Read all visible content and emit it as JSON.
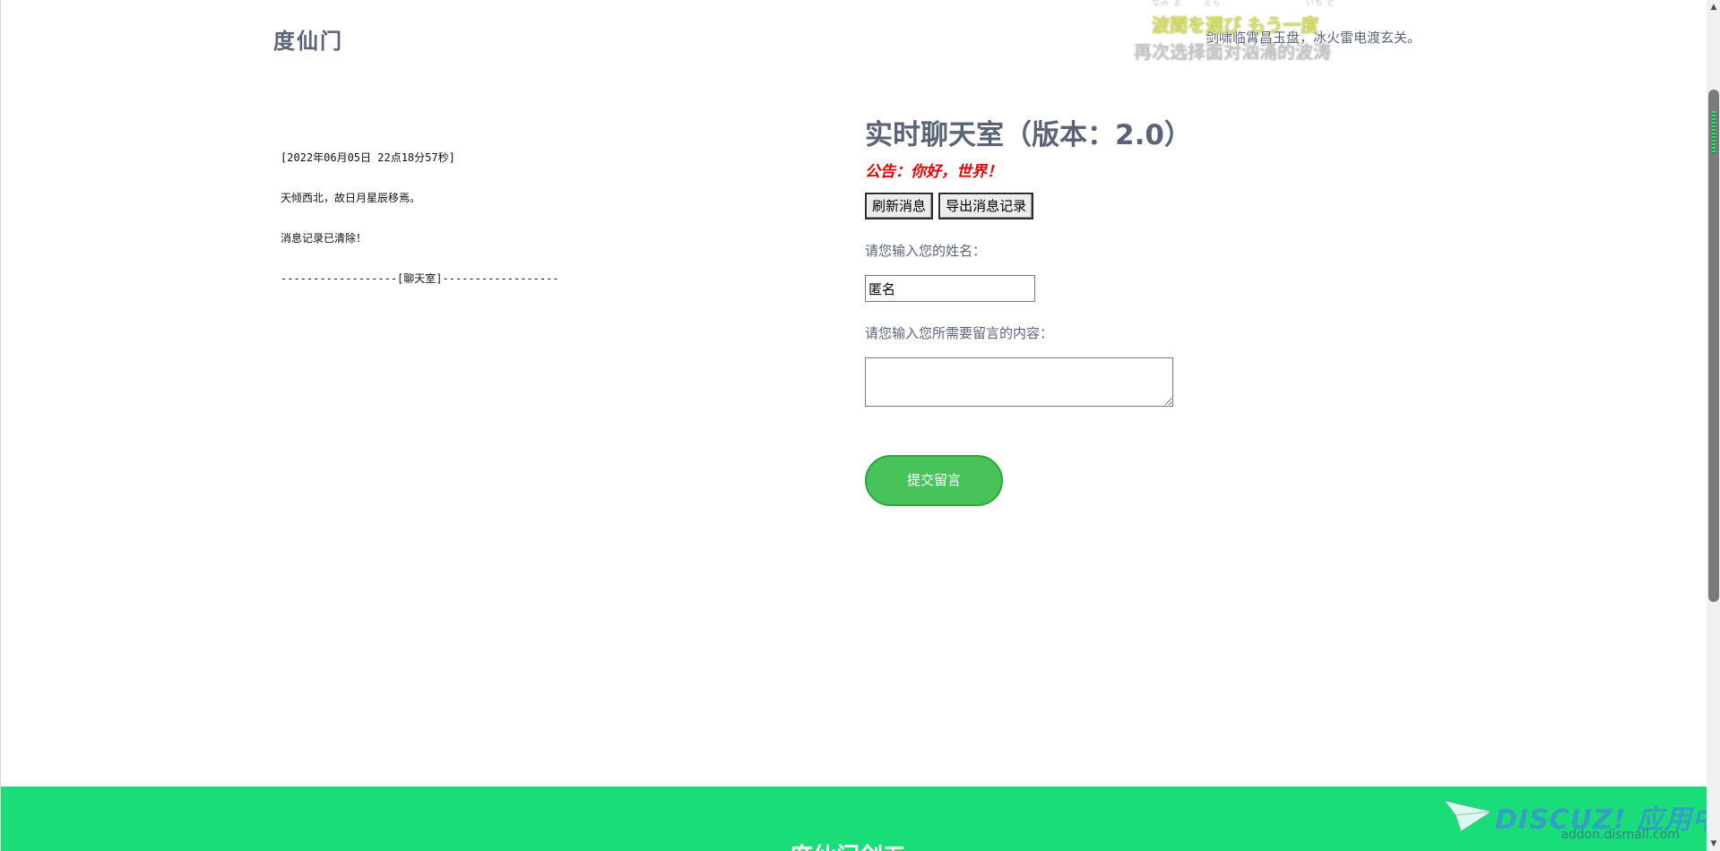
{
  "header": {
    "logo": "度仙门"
  },
  "lyrics": {
    "furigana": "なみ ま　　 えら　　　　　　　　　 いち ど",
    "japanese": "波間を選び もう一度",
    "chinese_behind": "剑啸临霄昌玉盘，冰火雷电渡玄关。",
    "chinese": "再次选择面对汹涌的波涛"
  },
  "chat_log": {
    "lines": [
      "[2022年06月05日 22点18分57秒]",
      "天倾西北，故日月星辰移焉。",
      "消息记录已清除！",
      "------------------[聊天室]------------------"
    ]
  },
  "chat": {
    "title": "实时聊天室（版本：2.0）",
    "notice": "公告：你好，世界！",
    "refresh_label": "刷新消息",
    "export_label": "导出消息记录",
    "name_label": "请您输入您的姓名：",
    "name_value": "匿名",
    "message_label": "请您输入您所需要留言的内容：",
    "message_value": "",
    "submit_label": "提交留言"
  },
  "footer": {
    "title": "度仙门剑五",
    "background_color": "#19dd79",
    "watermark_brand": "DISCUZ! 应用中心",
    "watermark_url": "addon.dismall.com"
  },
  "colors": {
    "accent_green": "#48c35a",
    "notice_red": "#e60000",
    "heading_gray": "#5b6477"
  }
}
